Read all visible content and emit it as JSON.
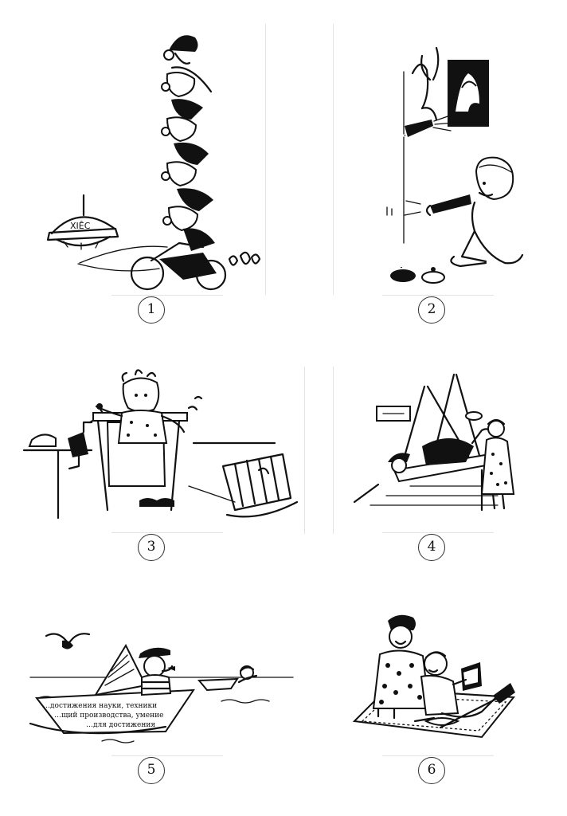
{
  "panels": [
    {
      "number": "1",
      "sign": "XIÊC"
    },
    {
      "number": "2"
    },
    {
      "number": "3"
    },
    {
      "number": "4"
    },
    {
      "number": "5",
      "paper_lines": [
        "…достижения науки, техники",
        "…щий производства, умение",
        "…для достижения"
      ]
    },
    {
      "number": "6"
    }
  ]
}
